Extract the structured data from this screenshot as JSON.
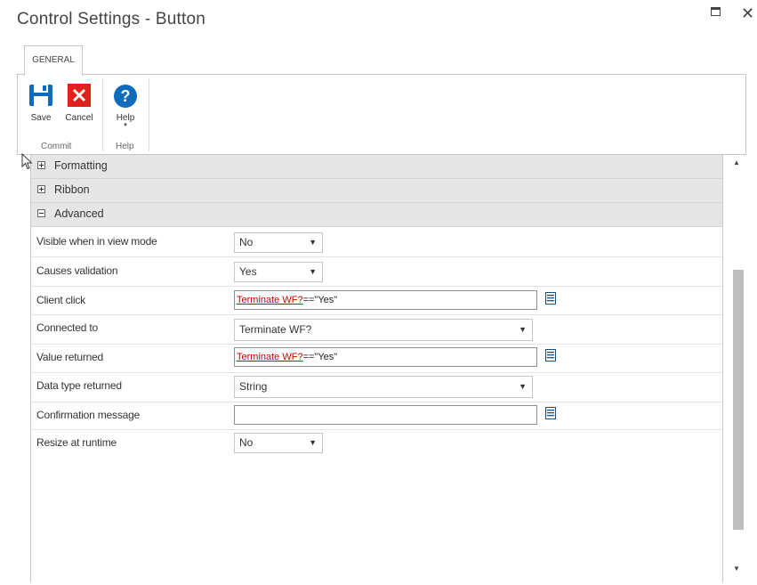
{
  "window": {
    "title": "Control Settings - Button",
    "maximize_icon": "maximize-icon",
    "close_icon": "close-icon",
    "close_glyph": "✕"
  },
  "tabs": [
    {
      "label": "GENERAL",
      "active": true
    }
  ],
  "ribbon": {
    "groups": [
      {
        "label": "Commit",
        "buttons": [
          {
            "label": "Save",
            "icon": "save-icon"
          },
          {
            "label": "Cancel",
            "icon": "cancel-icon"
          }
        ]
      },
      {
        "label": "Help",
        "buttons": [
          {
            "label": "Help",
            "icon": "help-icon",
            "has_dropdown": true
          }
        ]
      }
    ]
  },
  "sections": [
    {
      "label": "Formatting",
      "expanded": false
    },
    {
      "label": "Ribbon",
      "expanded": false
    },
    {
      "label": "Advanced",
      "expanded": true
    }
  ],
  "advanced": {
    "visible_in_view_mode": {
      "label": "Visible when in view mode",
      "value": "No"
    },
    "causes_validation": {
      "label": "Causes validation",
      "value": "Yes"
    },
    "client_click": {
      "label": "Client click",
      "token": "Terminate WF?",
      "rest": "==\"Yes\""
    },
    "connected_to": {
      "label": "Connected to",
      "value": "Terminate WF?"
    },
    "value_returned": {
      "label": "Value returned",
      "token": "Terminate WF?",
      "rest": "==\"Yes\""
    },
    "data_type_returned": {
      "label": "Data type returned",
      "value": "String"
    },
    "confirmation_message": {
      "label": "Confirmation message",
      "value": ""
    },
    "resize_at_runtime": {
      "label": "Resize at runtime",
      "value": "No"
    }
  },
  "glyphs": {
    "dropdown_arrow": "▼",
    "scroll_up": "▲",
    "scroll_down": "▼"
  },
  "colors": {
    "accent_blue": "#0f6cbd",
    "cancel_red": "#e3211c",
    "token_red": "#cc0000"
  }
}
